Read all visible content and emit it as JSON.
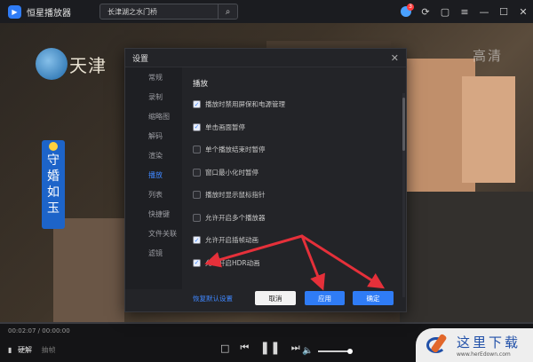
{
  "app": {
    "name": "恒星播放器",
    "logo_glyph": "▶"
  },
  "search": {
    "query": "长津湖之水门桥",
    "icon": "search-icon"
  },
  "window": {
    "notify_count": "3"
  },
  "video": {
    "channel_name": "天津",
    "hd_mark": "高清",
    "show_title_chars": [
      "守",
      "婚",
      "如",
      "玉"
    ]
  },
  "controls": {
    "time": "00:02:07 / 00:00:00",
    "quality_label": "硬解",
    "quality_alt": "抽帧",
    "volume_level": 0.75
  },
  "dialog": {
    "title": "设置",
    "nav": [
      {
        "label": "常规",
        "active": false
      },
      {
        "label": "录制",
        "active": false
      },
      {
        "label": "缩略图",
        "active": false
      },
      {
        "label": "解码",
        "active": false
      },
      {
        "label": "渲染",
        "active": false
      },
      {
        "label": "播放",
        "active": true
      },
      {
        "label": "列表",
        "active": false
      },
      {
        "label": "快捷键",
        "active": false
      },
      {
        "label": "文件关联",
        "active": false
      },
      {
        "label": "滤镜",
        "active": false
      }
    ],
    "section_title": "播放",
    "options": [
      {
        "label": "播放时禁用屏保和电源管理",
        "checked": true
      },
      {
        "label": "单击画面暂停",
        "checked": true
      },
      {
        "label": "单个播放结束时暂停",
        "checked": false
      },
      {
        "label": "窗口最小化时暂停",
        "checked": false
      },
      {
        "label": "播放时显示鼠标指针",
        "checked": false
      },
      {
        "label": "允许开启多个播放器",
        "checked": false
      },
      {
        "label": "允许开启插帧动画",
        "checked": true
      },
      {
        "label": "允许开启HDR动画",
        "checked": true
      }
    ],
    "reset_label": "恢复默认设置",
    "cancel_label": "取消",
    "apply_label": "应用",
    "ok_label": "确定"
  },
  "watermark": {
    "text": "这里下载",
    "url": "www.herEdown.com"
  },
  "colors": {
    "accent": "#2f7cf6",
    "arrow": "#e5303a",
    "dialog_bg": "#232428"
  }
}
